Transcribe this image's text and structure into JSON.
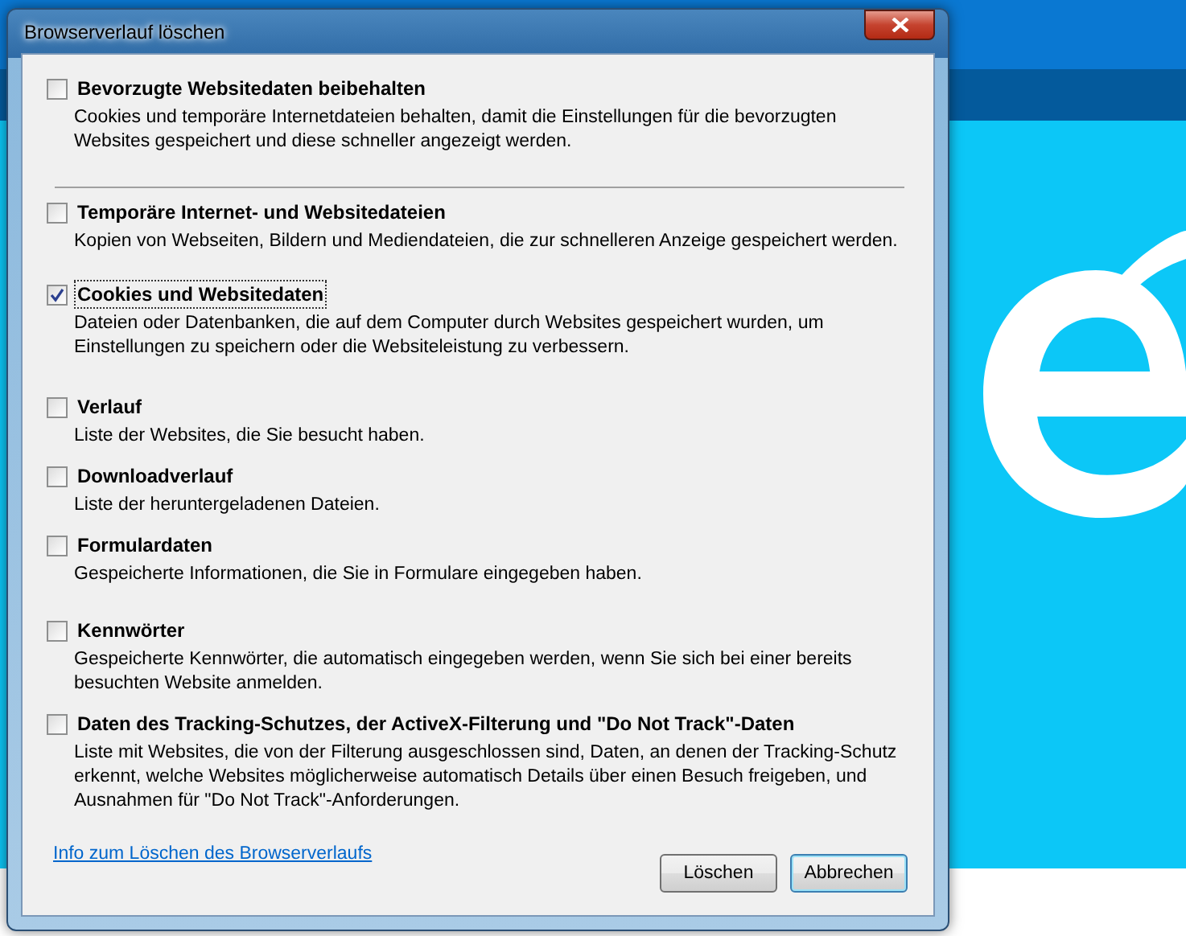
{
  "window": {
    "title": "Browserverlauf löschen"
  },
  "options": [
    {
      "label": "Bevorzugte Websitedaten beibehalten",
      "description": "Cookies und temporäre Internetdateien behalten, damit die Einstellungen für die bevorzugten Websites gespeichert und diese schneller angezeigt werden.",
      "checked": false,
      "focused": false
    },
    {
      "label": "Temporäre Internet- und Websitedateien",
      "description": "Kopien von Webseiten, Bildern und Mediendateien, die zur schnelleren Anzeige gespeichert werden.",
      "checked": false,
      "focused": false
    },
    {
      "label": "Cookies und Websitedaten",
      "description": "Dateien oder Datenbanken, die auf dem Computer durch Websites gespeichert wurden, um Einstellungen zu speichern oder die Websiteleistung zu verbessern.",
      "checked": true,
      "focused": true
    },
    {
      "label": "Verlauf",
      "description": "Liste der Websites, die Sie besucht haben.",
      "checked": false,
      "focused": false
    },
    {
      "label": "Downloadverlauf",
      "description": "Liste der heruntergeladenen Dateien.",
      "checked": false,
      "focused": false
    },
    {
      "label": "Formulardaten",
      "description": "Gespeicherte Informationen, die Sie in Formulare eingegeben haben.",
      "checked": false,
      "focused": false
    },
    {
      "label": "Kennwörter",
      "description": "Gespeicherte Kennwörter, die automatisch eingegeben werden, wenn Sie sich bei einer bereits besuchten Website anmelden.",
      "checked": false,
      "focused": false
    },
    {
      "label": "Daten des Tracking-Schutzes, der ActiveX-Filterung und \"Do Not Track\"-Daten",
      "description": "Liste mit Websites, die von der Filterung ausgeschlossen sind, Daten, an denen der Tracking-Schutz erkennt, welche Websites möglicherweise automatisch Details über einen Besuch freigeben, und Ausnahmen für \"Do Not Track\"-Anforderungen.",
      "checked": false,
      "focused": false
    }
  ],
  "info_link": "Info zum Löschen des Browserverlaufs",
  "buttons": [
    {
      "label": "Löschen",
      "default": false
    },
    {
      "label": "Abbrechen",
      "default": true
    }
  ]
}
